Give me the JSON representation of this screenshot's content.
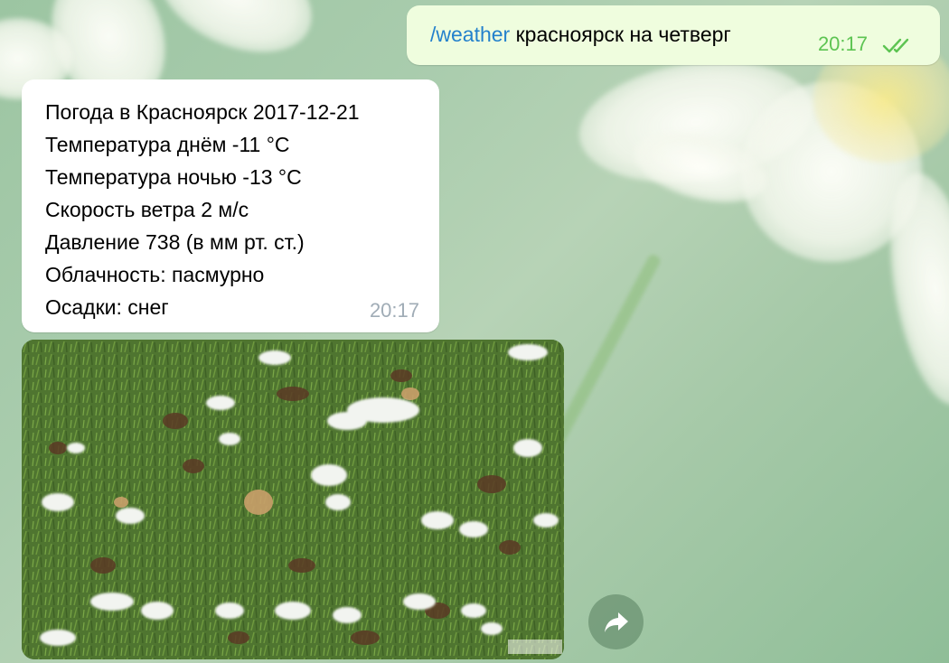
{
  "outgoing": {
    "command": "/weather",
    "text": " красноярск на четверг",
    "time": "20:17",
    "status_icon": "double-check-icon",
    "status_color": "#5dc452"
  },
  "incoming": {
    "lines": [
      "Погода в Красноярск 2017-12-21",
      "Температура днём -11 °C",
      "Температура ночью -13 °C",
      "Скорость ветра 2 м/с",
      "Давление 738 (в мм рт. ст.)",
      "Облачность: пасмурно",
      "Осадки: снег"
    ],
    "time": "20:17"
  },
  "photo": {
    "description_icon": "photo-snow-on-grass",
    "watermark": "СВЯНОЯРСК"
  },
  "share_button": {
    "icon": "share-arrow-icon"
  },
  "colors": {
    "link": "#2481cc",
    "outgoing_bubble": "#effdde",
    "incoming_bubble": "#ffffff",
    "incoming_time": "#a0acb6"
  }
}
